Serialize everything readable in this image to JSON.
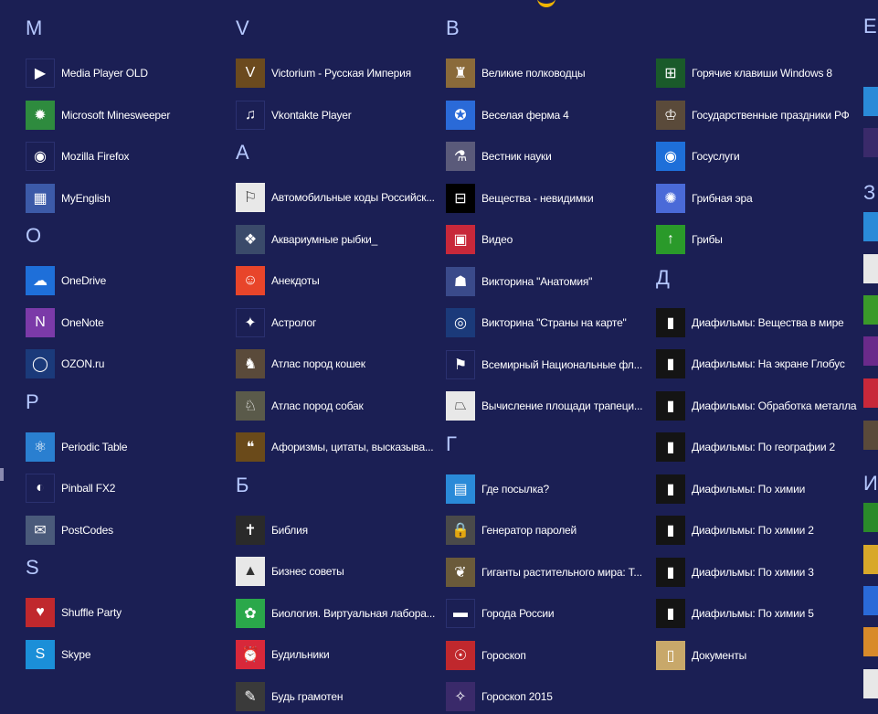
{
  "columns": [
    {
      "groups": [
        {
          "letter": "M",
          "items": [
            {
              "label": "Media Player OLD",
              "icon": "media-player-icon",
              "color": "#1b1f54"
            },
            {
              "label": "Microsoft Minesweeper",
              "icon": "minesweeper-icon",
              "color": "#2e8b3e"
            },
            {
              "label": "Mozilla Firefox",
              "icon": "firefox-icon",
              "color": "#1b1f54"
            },
            {
              "label": "MyEnglish",
              "icon": "myenglish-icon",
              "color": "#3c5aa8"
            }
          ]
        },
        {
          "letter": "O",
          "items": [
            {
              "label": "OneDrive",
              "icon": "onedrive-icon",
              "color": "#1e6fd9"
            },
            {
              "label": "OneNote",
              "icon": "onenote-icon",
              "color": "#7b3aa8"
            },
            {
              "label": "OZON.ru",
              "icon": "ozon-icon",
              "color": "#1b3a7a"
            }
          ]
        },
        {
          "letter": "P",
          "items": [
            {
              "label": "Periodic Table",
              "icon": "atom-icon",
              "color": "#2a7fd0"
            },
            {
              "label": "Pinball FX2",
              "icon": "pinball-icon",
              "color": "#1b1f54"
            },
            {
              "label": "PostCodes",
              "icon": "postcodes-icon",
              "color": "#4a5a7a"
            }
          ]
        },
        {
          "letter": "S",
          "items": [
            {
              "label": "Shuffle Party",
              "icon": "shuffle-party-icon",
              "color": "#c0282d"
            },
            {
              "label": "Skype",
              "icon": "skype-icon",
              "color": "#1b8fd8"
            }
          ]
        }
      ]
    },
    {
      "groups": [
        {
          "letter": "V",
          "items": [
            {
              "label": "Victorium - Русская Империя",
              "icon": "victorium-icon",
              "color": "#6b4a1e"
            },
            {
              "label": "Vkontakte Player",
              "icon": "vk-player-icon",
              "color": "#1b1f54"
            }
          ]
        },
        {
          "letter": "А",
          "items": [
            {
              "label": "Автомобильные коды Российск...",
              "icon": "car-codes-icon",
              "color": "#e8e8e8"
            },
            {
              "label": "Аквариумные рыбки_",
              "icon": "fish-icon",
              "color": "#3a4a6a"
            },
            {
              "label": "Анекдоты",
              "icon": "anecdotes-icon",
              "color": "#e8452a"
            },
            {
              "label": "Астролог",
              "icon": "astrologer-icon",
              "color": "#1b1f54"
            },
            {
              "label": "Атлас пород кошек",
              "icon": "cat-atlas-icon",
              "color": "#5a4a3a"
            },
            {
              "label": "Атлас пород собак",
              "icon": "dog-atlas-icon",
              "color": "#5a5a4a"
            },
            {
              "label": "Афоризмы, цитаты, высказыва...",
              "icon": "aphorisms-icon",
              "color": "#6a4a1a"
            }
          ]
        },
        {
          "letter": "Б",
          "items": [
            {
              "label": "Библия",
              "icon": "bible-icon",
              "color": "#2a2a2a"
            },
            {
              "label": "Бизнес советы",
              "icon": "business-icon",
              "color": "#e8e8e8"
            },
            {
              "label": "Биология. Виртуальная лабора...",
              "icon": "biology-icon",
              "color": "#2aa84a"
            },
            {
              "label": "Будильники",
              "icon": "alarm-icon",
              "color": "#d8283a"
            },
            {
              "label": "Будь грамотен",
              "icon": "literacy-icon",
              "color": "#3a3a3a"
            }
          ]
        }
      ]
    },
    {
      "groups": [
        {
          "letter": "В",
          "items": [
            {
              "label": "Великие полководцы",
              "icon": "commanders-icon",
              "color": "#8a6a3a"
            },
            {
              "label": "Веселая ферма 4",
              "icon": "farm-icon",
              "color": "#2a6ad8"
            },
            {
              "label": "Вестник науки",
              "icon": "science-icon",
              "color": "#5a5a7a"
            },
            {
              "label": "Вещества - невидимки",
              "icon": "substances-icon",
              "color": "#000000"
            },
            {
              "label": "Видео",
              "icon": "video-icon",
              "color": "#c8283a"
            },
            {
              "label": "Викторина \"Анатомия\"",
              "icon": "anatomy-icon",
              "color": "#3a4a8a"
            },
            {
              "label": "Викторина \"Страны на карте\"",
              "icon": "globe-icon",
              "color": "#1b3a7a"
            },
            {
              "label": "Всемирный Национальные фл...",
              "icon": "flags-icon",
              "color": "#1b1f54"
            },
            {
              "label": "Вычисление площади трапеци...",
              "icon": "trapezoid-icon",
              "color": "#e8e8e8"
            }
          ]
        },
        {
          "letter": "Г",
          "items": [
            {
              "label": "Где посылка?",
              "icon": "parcel-icon",
              "color": "#2a8ad8"
            },
            {
              "label": "Генератор паролей",
              "icon": "password-icon",
              "color": "#4a4a4a"
            },
            {
              "label": "Гиганты растительного мира: Т...",
              "icon": "plants-icon",
              "color": "#6a5a3a"
            },
            {
              "label": "Города России",
              "icon": "russia-flag-icon",
              "color": "#1b1f54"
            },
            {
              "label": "Гороскоп",
              "icon": "horoscope-icon",
              "color": "#c0282d"
            },
            {
              "label": "Гороскоп 2015",
              "icon": "horoscope-2015-icon",
              "color": "#3a2a6a"
            }
          ]
        }
      ]
    },
    {
      "groups": [
        {
          "letter": "",
          "items": [
            {
              "label": "Горячие клавиши Windows 8",
              "icon": "windows-icon",
              "color": "#1a5a2a"
            },
            {
              "label": "Государственные праздники РФ",
              "icon": "holidays-icon",
              "color": "#5a4a3a"
            },
            {
              "label": "Госуслуги",
              "icon": "gosuslugi-icon",
              "color": "#1e6fd9"
            },
            {
              "label": "Грибная эра",
              "icon": "mushroom-era-icon",
              "color": "#4a6ad8"
            },
            {
              "label": "Грибы",
              "icon": "mushrooms-icon",
              "color": "#2a9a2a"
            }
          ]
        },
        {
          "letter": "Д",
          "items": [
            {
              "label": "Диафильмы: Вещества в мире",
              "icon": "filmstrip-icon",
              "color": "#141414"
            },
            {
              "label": "Диафильмы: На экране Глобус",
              "icon": "filmstrip-icon",
              "color": "#141414"
            },
            {
              "label": "Диафильмы: Обработка металла",
              "icon": "filmstrip-icon",
              "color": "#141414"
            },
            {
              "label": "Диафильмы: По географии 2",
              "icon": "filmstrip-icon",
              "color": "#141414"
            },
            {
              "label": "Диафильмы: По химии",
              "icon": "filmstrip-icon",
              "color": "#141414"
            },
            {
              "label": "Диафильмы: По химии 2",
              "icon": "filmstrip-icon",
              "color": "#141414"
            },
            {
              "label": "Диафильмы: По химии 3",
              "icon": "filmstrip-icon",
              "color": "#141414"
            },
            {
              "label": "Диафильмы: По химии 5",
              "icon": "filmstrip-icon",
              "color": "#141414"
            },
            {
              "label": "Документы",
              "icon": "documents-icon",
              "color": "#c8a86a"
            }
          ]
        }
      ]
    }
  ],
  "edge_letters": [
    "Е,",
    "З",
    "И"
  ],
  "edge_tile_colors": [
    "#1b1f54",
    "#2a8ad8",
    "#3a2a6a",
    "#2a8ad8",
    "#e8e8e8",
    "#3a9a2a",
    "#6a2a8a",
    "#c8283a",
    "#5a4a3a",
    "#2a8a2a",
    "#d8a82a",
    "#2a6ad8",
    "#d88a2a",
    "#e8e8e8"
  ]
}
